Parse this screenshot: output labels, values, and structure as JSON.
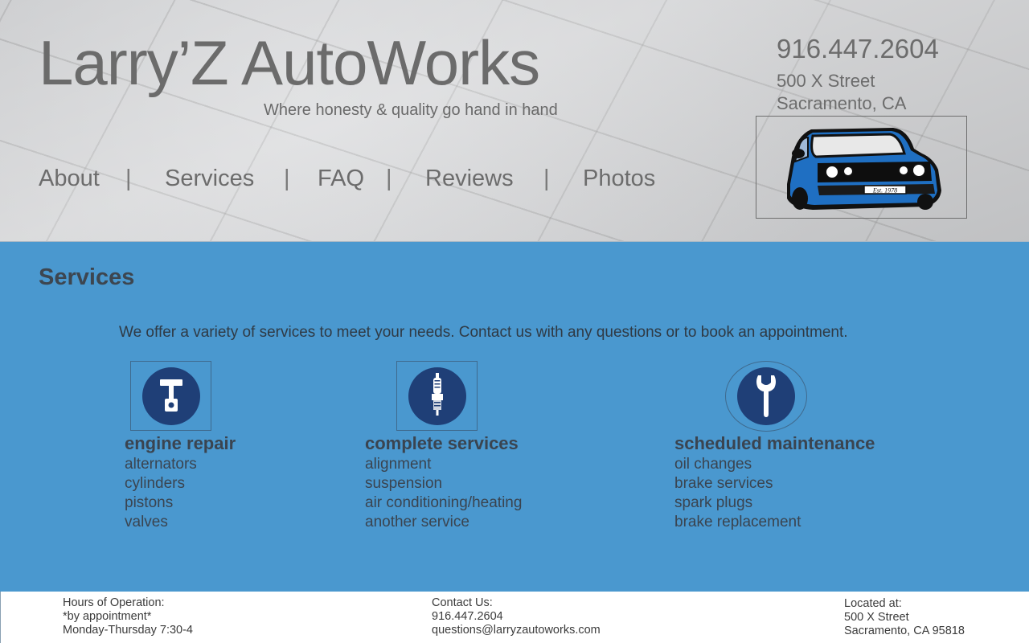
{
  "header": {
    "title": "Larry’Z AutoWorks",
    "tagline": "Where honesty & quality go hand in hand",
    "phone": "916.447.2604",
    "address_line1": "500 X Street",
    "address_line2": "Sacramento, CA",
    "logo_badge": "Est. 1978"
  },
  "nav": {
    "items": [
      {
        "label": "About"
      },
      {
        "label": "Services"
      },
      {
        "label": "FAQ"
      },
      {
        "label": "Reviews"
      },
      {
        "label": "Photos"
      }
    ],
    "separator": "|"
  },
  "main": {
    "title": "Services",
    "intro": "We offer a variety of services to meet your needs. Contact us with any questions or to book an appointment.",
    "services": [
      {
        "icon": "piston-icon",
        "heading": "engine repair",
        "items": [
          "alternators",
          "cylinders",
          "pistons",
          "valves"
        ]
      },
      {
        "icon": "spark-plug-icon",
        "heading": "complete services",
        "items": [
          "alignment",
          "suspension",
          "air conditioning/heating",
          "another service"
        ]
      },
      {
        "icon": "wrench-icon",
        "heading": "scheduled maintenance",
        "items": [
          "oil changes",
          "brake services",
          "spark plugs",
          "brake replacement"
        ]
      }
    ]
  },
  "footer": {
    "hours": {
      "label": "Hours of Operation:",
      "line1": "*by appointment*",
      "line2": "Monday-Thursday 7:30-4"
    },
    "contact": {
      "label": "Contact Us:",
      "phone": "916.447.2604",
      "email": "questions@larryzautoworks.com"
    },
    "location": {
      "label": "Located at:",
      "line1": "500 X Street",
      "line2": "Sacramento, CA 95818"
    }
  },
  "colors": {
    "header_bg": "#cfd0d2",
    "main_bg": "#4a98cf",
    "icon_circle": "#1f3f77",
    "car_body": "#1f6fc2",
    "text_gray": "#6b6b6b"
  }
}
